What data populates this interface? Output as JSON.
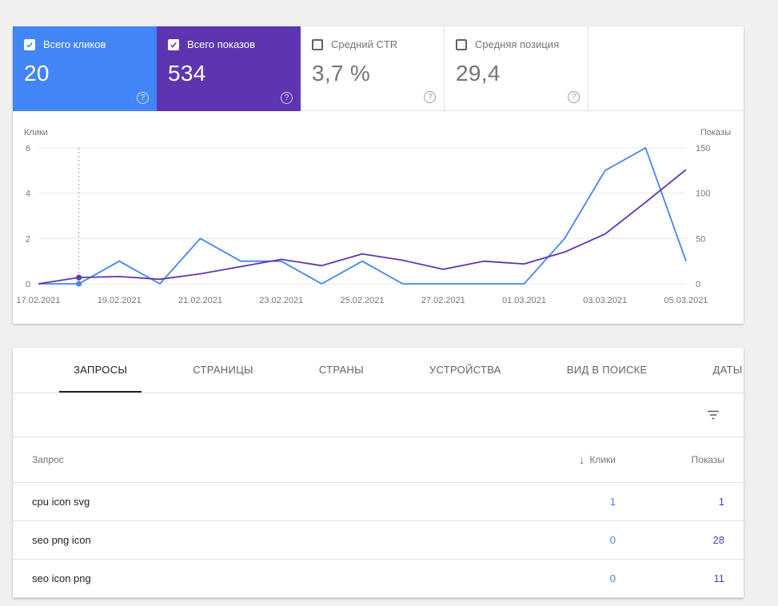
{
  "metric_cards": [
    {
      "label": "Всего кликов",
      "value": "20",
      "checked": true,
      "color": "#4285f4"
    },
    {
      "label": "Всего показов",
      "value": "534",
      "checked": true,
      "color": "#5e35b1"
    },
    {
      "label": "Средний CTR",
      "value": "3,7 %",
      "checked": false,
      "color": null
    },
    {
      "label": "Средняя позиция",
      "value": "29,4",
      "checked": false,
      "color": null
    }
  ],
  "icons": {
    "help": "?",
    "filter": "filter-list",
    "sort": "↓",
    "check": "checkmark"
  },
  "chart_data": {
    "type": "line",
    "x": [
      "17.02.2021",
      "18.02.2021",
      "19.02.2021",
      "20.02.2021",
      "21.02.2021",
      "22.02.2021",
      "23.02.2021",
      "24.02.2021",
      "25.02.2021",
      "26.02.2021",
      "27.02.2021",
      "28.02.2021",
      "01.03.2021",
      "02.03.2021",
      "03.03.2021",
      "04.03.2021",
      "05.03.2021"
    ],
    "x_tick_labels": [
      "17.02.2021",
      "19.02.2021",
      "21.02.2021",
      "23.02.2021",
      "25.02.2021",
      "27.02.2021",
      "01.03.2021",
      "03.03.2021",
      "05.03.2021"
    ],
    "series": [
      {
        "name": "Клики",
        "axis": "left",
        "color": "#4285f4",
        "values": [
          0,
          0,
          1,
          0,
          2,
          1,
          1,
          0,
          1,
          0,
          0,
          0,
          0,
          2,
          5,
          6,
          1
        ]
      },
      {
        "name": "Показы",
        "axis": "right",
        "color": "#5e35b1",
        "values": [
          0,
          7,
          8,
          5,
          11,
          19,
          27,
          20,
          33,
          26,
          16,
          25,
          22,
          35,
          55,
          90,
          126
        ]
      }
    ],
    "left_axis": {
      "label": "Клики",
      "ticks": [
        0,
        2,
        4,
        6
      ],
      "max": 6
    },
    "right_axis": {
      "label": "Показы",
      "ticks": [
        0,
        50,
        100,
        150
      ],
      "max": 150
    },
    "marker_index": 1,
    "grid": true,
    "legend_position": "none"
  },
  "tabs": [
    {
      "label": "ЗАПРОСЫ",
      "active": true
    },
    {
      "label": "СТРАНИЦЫ",
      "active": false
    },
    {
      "label": "СТРАНЫ",
      "active": false
    },
    {
      "label": "УСТРОЙСТВА",
      "active": false
    },
    {
      "label": "ВИД В ПОИСКЕ",
      "active": false
    },
    {
      "label": "ДАТЫ",
      "active": false
    }
  ],
  "table": {
    "header": {
      "query": "Запрос",
      "clicks": "Клики",
      "impressions": "Показы",
      "sort_arrow": "↓"
    },
    "rows": [
      {
        "query": "cpu icon svg",
        "clicks": "1",
        "impressions": "1"
      },
      {
        "query": "seo png icon",
        "clicks": "0",
        "impressions": "28"
      },
      {
        "query": "seo icon png",
        "clicks": "0",
        "impressions": "11"
      }
    ]
  },
  "colors": {
    "clicks": "#4285f4",
    "impressions": "#5e35b1",
    "active_tab": "#202124"
  }
}
